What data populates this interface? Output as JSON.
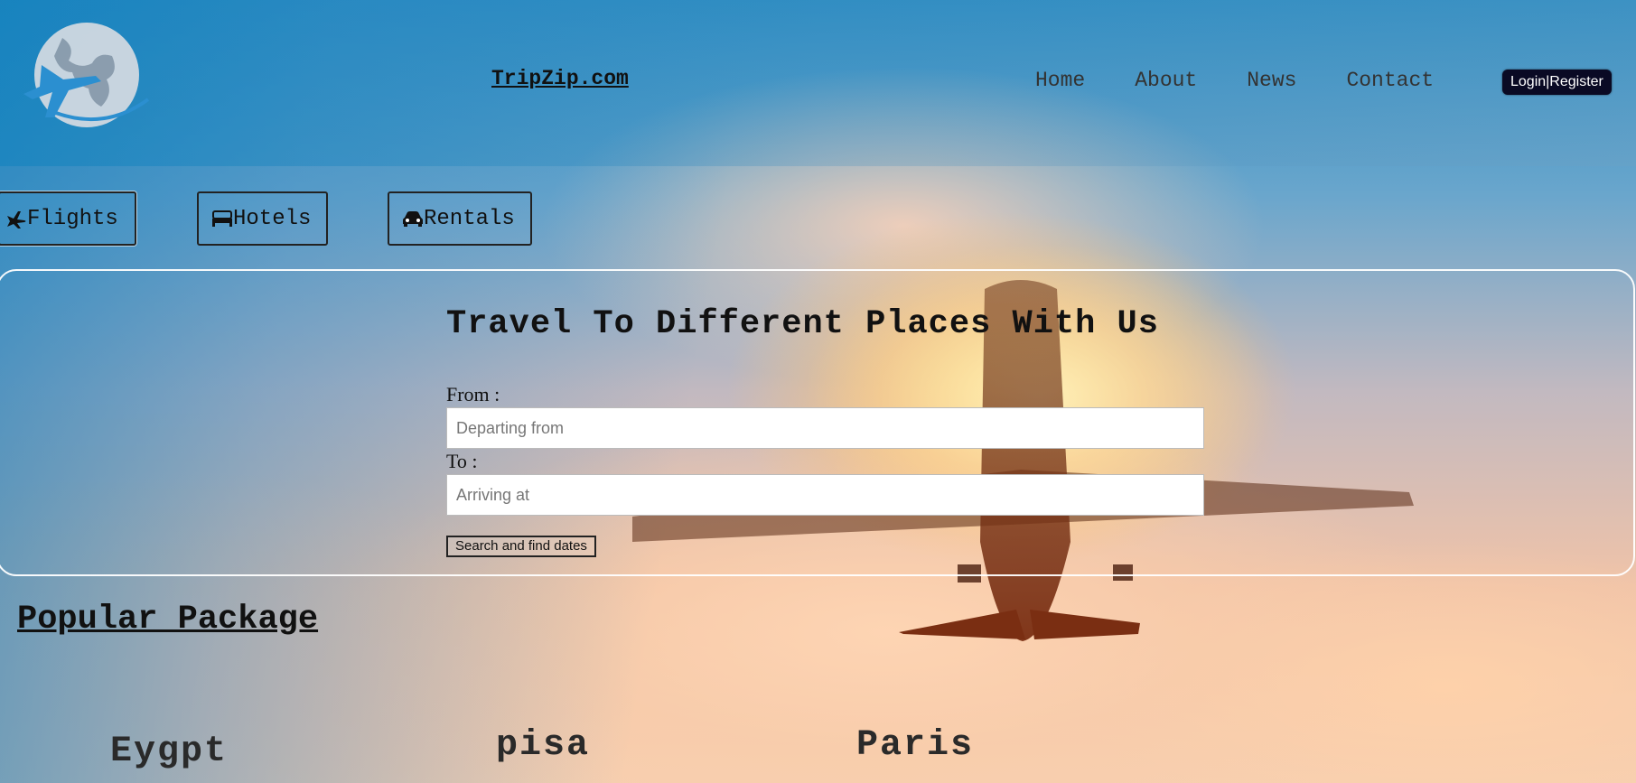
{
  "header": {
    "logo_icon": "globe-airplane-logo",
    "site_title": "TripZip.com",
    "nav": [
      {
        "label": "Home"
      },
      {
        "label": "About"
      },
      {
        "label": "News"
      },
      {
        "label": "Contact"
      }
    ],
    "login_label": "Login|Register"
  },
  "tabs": [
    {
      "label": "Flights",
      "icon": "airplane-icon"
    },
    {
      "label": "Hotels",
      "icon": "bed-icon"
    },
    {
      "label": "Rentals",
      "icon": "car-icon"
    }
  ],
  "search": {
    "title": "Travel To Different Places With Us",
    "from_label": "From :",
    "from_placeholder": "Departing from",
    "to_label": "To :",
    "to_placeholder": "Arriving at",
    "button_label": "Search and find dates"
  },
  "popular": {
    "title": "Popular Package",
    "destinations": [
      {
        "name": "Eygpt"
      },
      {
        "name": "pisa"
      },
      {
        "name": "Paris"
      }
    ]
  },
  "colors": {
    "logo_color": "#2b8fd0",
    "logo_globe": "#d9dde2",
    "login_bg": "#0a0a24"
  }
}
